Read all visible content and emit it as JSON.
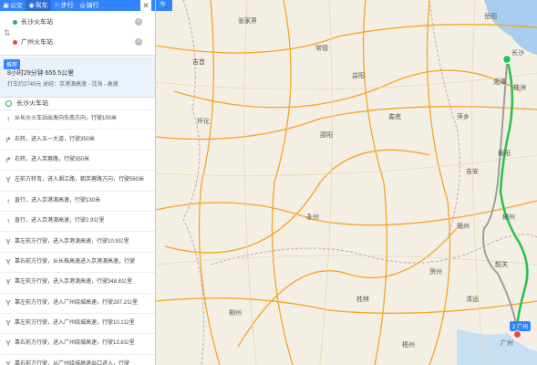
{
  "modes": [
    {
      "label": "公交",
      "glyph": "▣"
    },
    {
      "label": "驾车",
      "glyph": "◉"
    },
    {
      "label": "步行",
      "glyph": "⚐"
    },
    {
      "label": "骑行",
      "glyph": "◎"
    }
  ],
  "close_glyph": "✕",
  "search_glyph": "🔍",
  "route": {
    "origin": "长沙火车站",
    "destination": "广州火车站",
    "swap_glyph": "⇅",
    "clear_glyph": "×"
  },
  "summary": {
    "tag": "推荐",
    "line1": "8小时29分钟   655.5公里",
    "line2": "打车约2740元     途经：京港澳高速 - 沈海 - 高速"
  },
  "start_label": "长沙火车站",
  "steps": [
    {
      "icon": "↑",
      "text": "从长沙火车站出发向东南方向，行驶150米"
    },
    {
      "icon": "↱",
      "text": "右转，进入五一大道，行驶350米"
    },
    {
      "icon": "↱",
      "text": "右转，进入芙蓉路，行驶350米"
    },
    {
      "icon": "Y",
      "text": "左前方转弯，进入湘江路，朝芙蓉路方向，行驶560米"
    },
    {
      "icon": "↑",
      "text": "直行，进入京港澳高速，行驶130米"
    },
    {
      "icon": "↑",
      "text": "直行，进入京港澳高速，行驶2.9公里"
    },
    {
      "icon": "Y",
      "text": "靠左前方行驶，进入京港澳高速，行驶10.9公里"
    },
    {
      "icon": "Y",
      "text": "靠右前方行驶，从长株高速进入京港澳高速，行驶"
    },
    {
      "icon": "Y",
      "text": "靠左前方行驶，进入京港澳高速，行驶348.8公里"
    },
    {
      "icon": "Y",
      "text": "靠左前方行驶，进入广州绕城高速，行驶287.2公里"
    },
    {
      "icon": "Y",
      "text": "靠左前方行驶，进入广州绕城高速，行驶10.1公里"
    },
    {
      "icon": "Y",
      "text": "靠右前方行驶，进入广州绕城高速，行驶13.8公里"
    },
    {
      "icon": "Y",
      "text": "靠右前方行驶，从广州绕城高速出口进入，行驶"
    }
  ],
  "map": {
    "cities": [
      "长沙",
      "湘潭",
      "株洲",
      "衡阳",
      "郴州",
      "韶关",
      "清远",
      "广州",
      "邵阳",
      "永州",
      "怀化",
      "吉首",
      "张家界",
      "常德",
      "益阳",
      "娄底",
      "桂林",
      "柳州",
      "贺州",
      "梧州",
      "岳阳",
      "萍乡",
      "吉安",
      "赣州"
    ],
    "dest_badge": "2 广州",
    "route_color": "#2ec24d",
    "alt_route_color": "#9e9e9e",
    "highway_color": "#f5a623",
    "water_color": "#a9cdee"
  }
}
